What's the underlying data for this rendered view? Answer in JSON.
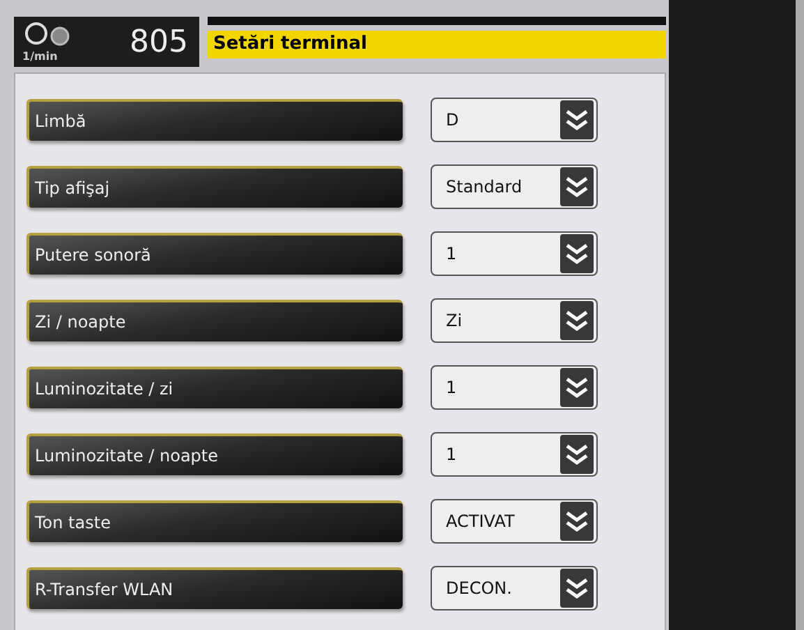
{
  "status": {
    "unit": "1/min",
    "value": "805"
  },
  "title": "Setări terminal",
  "settings": [
    {
      "label": "Limbă",
      "value": "D"
    },
    {
      "label": "Tip afişaj",
      "value": "Standard"
    },
    {
      "label": "Putere sonoră",
      "value": "1"
    },
    {
      "label": "Zi / noapte",
      "value": "Zi"
    },
    {
      "label": "Luminozitate / zi",
      "value": "1"
    },
    {
      "label": "Luminozitate / noapte",
      "value": "1"
    },
    {
      "label": "Ton taste",
      "value": "ACTIVAT"
    },
    {
      "label": "R-Transfer WLAN",
      "value": "DECON."
    }
  ]
}
